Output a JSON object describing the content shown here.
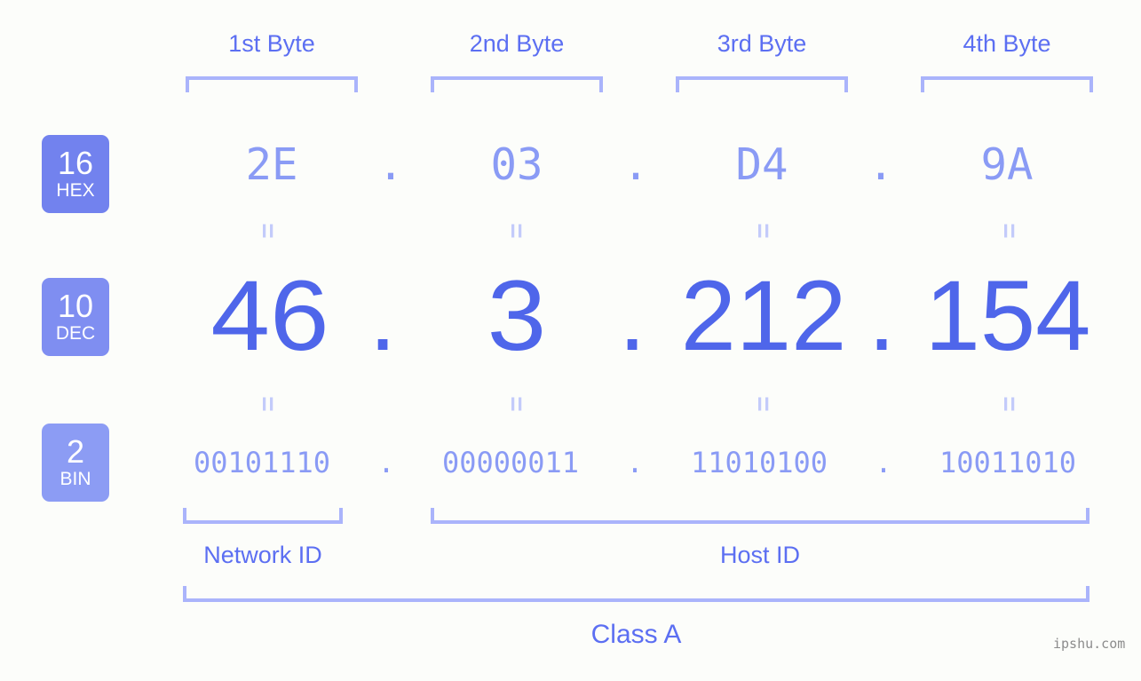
{
  "watermark": "ipshu.com",
  "colors": {
    "background": "#fcfdfa",
    "accent_strong": "#4f66ea",
    "accent_mid": "#5c6ff2",
    "accent_light": "#8a9bf5",
    "bracket": "#aab4fb",
    "badge_dark": "#7282ee",
    "badge_light": "#8c9cf4",
    "equals": "#c3cbfa",
    "watermark": "#8c8c8c"
  },
  "byte_headers": [
    {
      "label": "1st Byte"
    },
    {
      "label": "2nd Byte"
    },
    {
      "label": "3rd Byte"
    },
    {
      "label": "4th Byte"
    }
  ],
  "bases": [
    {
      "number": "16",
      "name": "HEX"
    },
    {
      "number": "10",
      "name": "DEC"
    },
    {
      "number": "2",
      "name": "BIN"
    }
  ],
  "separator": ".",
  "equals_symbol": "=",
  "rows": {
    "hex": {
      "values": [
        "2E",
        "03",
        "D4",
        "9A"
      ]
    },
    "dec": {
      "values": [
        "46",
        "3",
        "212",
        "154"
      ]
    },
    "bin": {
      "values": [
        "00101110",
        "00000011",
        "11010100",
        "10011010"
      ]
    }
  },
  "sections": [
    {
      "label": "Network ID"
    },
    {
      "label": "Host ID"
    }
  ],
  "class": {
    "label": "Class A"
  }
}
